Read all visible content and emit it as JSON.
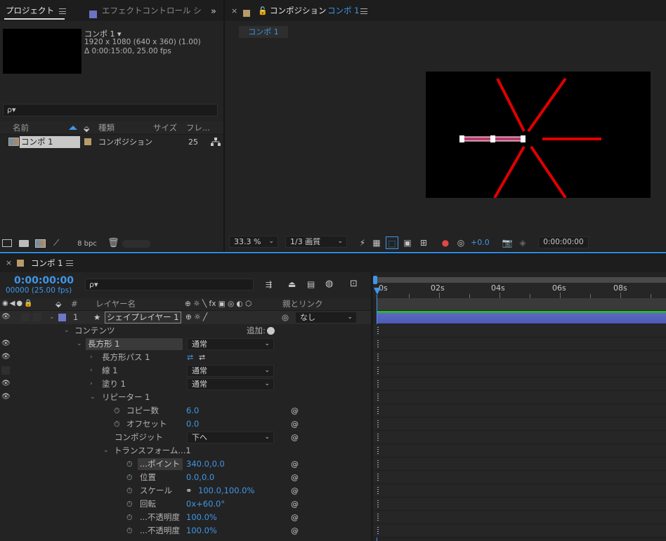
{
  "project_panel": {
    "tab_active": "プロジェクト",
    "tab_effects": "エフェクトコントロール シ",
    "comp_name": "コンポ 1 ▾",
    "comp_size": "1920 x 1080  (640 x 360) (1.00)",
    "comp_duration": "Δ 0:00:15:00, 25.00 fps",
    "search_placeholder": "ρ▾",
    "columns": {
      "name": "名前",
      "type": "種類",
      "size": "サイズ",
      "frames": "フレ..."
    },
    "items": [
      {
        "name": "コンポ 1",
        "type": "コンポジション",
        "size": "",
        "frames": "25"
      }
    ],
    "bpc": "8 bpc"
  },
  "comp_panel": {
    "tab_label": "コンポジション",
    "tab_comp": "コンポ 1",
    "viewer_tab": "コンポ 1",
    "zoom": "33.3 %",
    "quality": "1/3 画質",
    "exposure": "+0.0",
    "timecode": "0:00:00:00"
  },
  "timeline": {
    "tab_name": "コンポ 1",
    "timecode": "0:00:00:00",
    "frame_info": "00000 (25.00 fps)",
    "search_placeholder": "ρ▾",
    "col_number": "#",
    "col_layer_name": "レイヤー名",
    "col_switches": "⊕ ☼ ╲ fx ▣ ◎ ◐ ⬡",
    "col_parent": "親とリンク",
    "ruler": [
      "0s",
      "02s",
      "04s",
      "06s",
      "08s"
    ],
    "layer": {
      "number": "1",
      "name": "シェイプレイヤー 1",
      "parent": "なし"
    },
    "add_label": "追加:",
    "rows": {
      "contents": "コンテンツ",
      "rect": "長方形 1",
      "rect_mode": "通常",
      "rect_path": "長方形パス 1",
      "stroke": "線 1",
      "stroke_mode": "通常",
      "fill": "塗り 1",
      "fill_mode": "通常",
      "repeater": "リピーター 1",
      "copies": "コピー数",
      "copies_val": "6.0",
      "offset": "オフセット",
      "offset_val": "0.0",
      "composite": "コンポジット",
      "composite_val": "下へ",
      "transform": "トランスフォーム...1",
      "anchor": "...ポイント",
      "anchor_val": "340.0,0.0",
      "position": "位置",
      "position_val": "0.0,0.0",
      "scale": "スケール",
      "scale_val": "100.0,100.0%",
      "rotation": "回転",
      "rotation_val": "0x+60.0°",
      "start_opacity": "...不透明度",
      "start_opacity_val": "100.0%",
      "end_opacity": "...不透明度",
      "end_opacity_val": "100.0%"
    }
  },
  "colors": {
    "accent": "#3f96e8",
    "layer_label": "#6e78c8",
    "layer_bar": "#5e6bbf",
    "rays": "#e00000",
    "bar_pink": "#e04a6e"
  }
}
